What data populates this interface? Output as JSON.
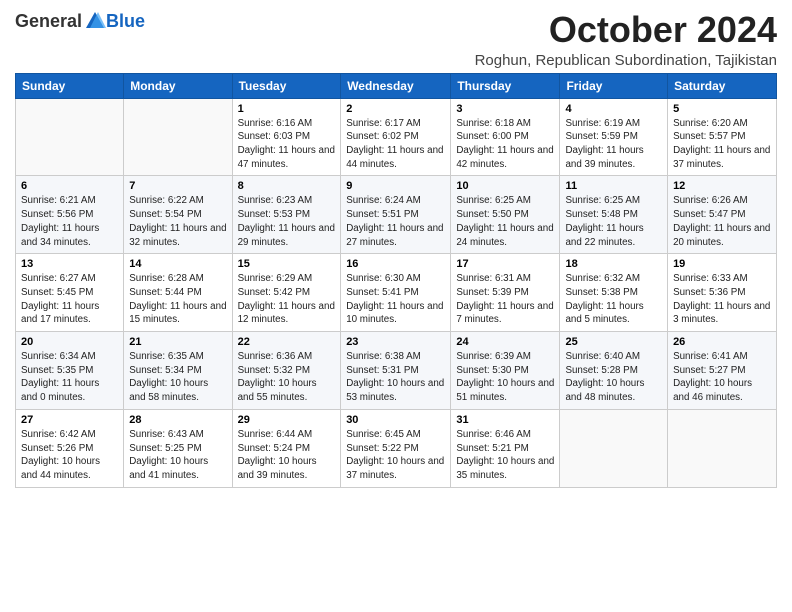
{
  "logo": {
    "general": "General",
    "blue": "Blue"
  },
  "header": {
    "month": "October 2024",
    "location": "Roghun, Republican Subordination, Tajikistan"
  },
  "weekdays": [
    "Sunday",
    "Monday",
    "Tuesday",
    "Wednesday",
    "Thursday",
    "Friday",
    "Saturday"
  ],
  "weeks": [
    [
      {
        "day": "",
        "sunrise": "",
        "sunset": "",
        "daylight": ""
      },
      {
        "day": "",
        "sunrise": "",
        "sunset": "",
        "daylight": ""
      },
      {
        "day": "1",
        "sunrise": "Sunrise: 6:16 AM",
        "sunset": "Sunset: 6:03 PM",
        "daylight": "Daylight: 11 hours and 47 minutes."
      },
      {
        "day": "2",
        "sunrise": "Sunrise: 6:17 AM",
        "sunset": "Sunset: 6:02 PM",
        "daylight": "Daylight: 11 hours and 44 minutes."
      },
      {
        "day": "3",
        "sunrise": "Sunrise: 6:18 AM",
        "sunset": "Sunset: 6:00 PM",
        "daylight": "Daylight: 11 hours and 42 minutes."
      },
      {
        "day": "4",
        "sunrise": "Sunrise: 6:19 AM",
        "sunset": "Sunset: 5:59 PM",
        "daylight": "Daylight: 11 hours and 39 minutes."
      },
      {
        "day": "5",
        "sunrise": "Sunrise: 6:20 AM",
        "sunset": "Sunset: 5:57 PM",
        "daylight": "Daylight: 11 hours and 37 minutes."
      }
    ],
    [
      {
        "day": "6",
        "sunrise": "Sunrise: 6:21 AM",
        "sunset": "Sunset: 5:56 PM",
        "daylight": "Daylight: 11 hours and 34 minutes."
      },
      {
        "day": "7",
        "sunrise": "Sunrise: 6:22 AM",
        "sunset": "Sunset: 5:54 PM",
        "daylight": "Daylight: 11 hours and 32 minutes."
      },
      {
        "day": "8",
        "sunrise": "Sunrise: 6:23 AM",
        "sunset": "Sunset: 5:53 PM",
        "daylight": "Daylight: 11 hours and 29 minutes."
      },
      {
        "day": "9",
        "sunrise": "Sunrise: 6:24 AM",
        "sunset": "Sunset: 5:51 PM",
        "daylight": "Daylight: 11 hours and 27 minutes."
      },
      {
        "day": "10",
        "sunrise": "Sunrise: 6:25 AM",
        "sunset": "Sunset: 5:50 PM",
        "daylight": "Daylight: 11 hours and 24 minutes."
      },
      {
        "day": "11",
        "sunrise": "Sunrise: 6:25 AM",
        "sunset": "Sunset: 5:48 PM",
        "daylight": "Daylight: 11 hours and 22 minutes."
      },
      {
        "day": "12",
        "sunrise": "Sunrise: 6:26 AM",
        "sunset": "Sunset: 5:47 PM",
        "daylight": "Daylight: 11 hours and 20 minutes."
      }
    ],
    [
      {
        "day": "13",
        "sunrise": "Sunrise: 6:27 AM",
        "sunset": "Sunset: 5:45 PM",
        "daylight": "Daylight: 11 hours and 17 minutes."
      },
      {
        "day": "14",
        "sunrise": "Sunrise: 6:28 AM",
        "sunset": "Sunset: 5:44 PM",
        "daylight": "Daylight: 11 hours and 15 minutes."
      },
      {
        "day": "15",
        "sunrise": "Sunrise: 6:29 AM",
        "sunset": "Sunset: 5:42 PM",
        "daylight": "Daylight: 11 hours and 12 minutes."
      },
      {
        "day": "16",
        "sunrise": "Sunrise: 6:30 AM",
        "sunset": "Sunset: 5:41 PM",
        "daylight": "Daylight: 11 hours and 10 minutes."
      },
      {
        "day": "17",
        "sunrise": "Sunrise: 6:31 AM",
        "sunset": "Sunset: 5:39 PM",
        "daylight": "Daylight: 11 hours and 7 minutes."
      },
      {
        "day": "18",
        "sunrise": "Sunrise: 6:32 AM",
        "sunset": "Sunset: 5:38 PM",
        "daylight": "Daylight: 11 hours and 5 minutes."
      },
      {
        "day": "19",
        "sunrise": "Sunrise: 6:33 AM",
        "sunset": "Sunset: 5:36 PM",
        "daylight": "Daylight: 11 hours and 3 minutes."
      }
    ],
    [
      {
        "day": "20",
        "sunrise": "Sunrise: 6:34 AM",
        "sunset": "Sunset: 5:35 PM",
        "daylight": "Daylight: 11 hours and 0 minutes."
      },
      {
        "day": "21",
        "sunrise": "Sunrise: 6:35 AM",
        "sunset": "Sunset: 5:34 PM",
        "daylight": "Daylight: 10 hours and 58 minutes."
      },
      {
        "day": "22",
        "sunrise": "Sunrise: 6:36 AM",
        "sunset": "Sunset: 5:32 PM",
        "daylight": "Daylight: 10 hours and 55 minutes."
      },
      {
        "day": "23",
        "sunrise": "Sunrise: 6:38 AM",
        "sunset": "Sunset: 5:31 PM",
        "daylight": "Daylight: 10 hours and 53 minutes."
      },
      {
        "day": "24",
        "sunrise": "Sunrise: 6:39 AM",
        "sunset": "Sunset: 5:30 PM",
        "daylight": "Daylight: 10 hours and 51 minutes."
      },
      {
        "day": "25",
        "sunrise": "Sunrise: 6:40 AM",
        "sunset": "Sunset: 5:28 PM",
        "daylight": "Daylight: 10 hours and 48 minutes."
      },
      {
        "day": "26",
        "sunrise": "Sunrise: 6:41 AM",
        "sunset": "Sunset: 5:27 PM",
        "daylight": "Daylight: 10 hours and 46 minutes."
      }
    ],
    [
      {
        "day": "27",
        "sunrise": "Sunrise: 6:42 AM",
        "sunset": "Sunset: 5:26 PM",
        "daylight": "Daylight: 10 hours and 44 minutes."
      },
      {
        "day": "28",
        "sunrise": "Sunrise: 6:43 AM",
        "sunset": "Sunset: 5:25 PM",
        "daylight": "Daylight: 10 hours and 41 minutes."
      },
      {
        "day": "29",
        "sunrise": "Sunrise: 6:44 AM",
        "sunset": "Sunset: 5:24 PM",
        "daylight": "Daylight: 10 hours and 39 minutes."
      },
      {
        "day": "30",
        "sunrise": "Sunrise: 6:45 AM",
        "sunset": "Sunset: 5:22 PM",
        "daylight": "Daylight: 10 hours and 37 minutes."
      },
      {
        "day": "31",
        "sunrise": "Sunrise: 6:46 AM",
        "sunset": "Sunset: 5:21 PM",
        "daylight": "Daylight: 10 hours and 35 minutes."
      },
      {
        "day": "",
        "sunrise": "",
        "sunset": "",
        "daylight": ""
      },
      {
        "day": "",
        "sunrise": "",
        "sunset": "",
        "daylight": ""
      }
    ]
  ]
}
